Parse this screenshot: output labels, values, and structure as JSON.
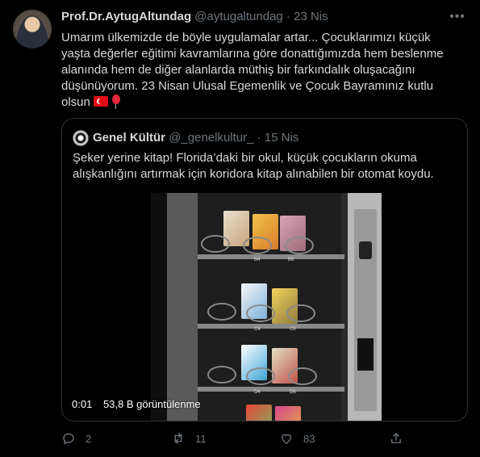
{
  "tweet": {
    "author_name": "Prof.Dr.AytugAltundag",
    "handle": "@aytugaltundag",
    "separator": "·",
    "date": "23 Nis",
    "more_label": "•••",
    "text": "Umarım ülkemizde de böyle uygulamalar artar... Çocuklarımızı küçük yaşta değerler eğitimi kavramlarına göre donattığımızda hem beslenme alanında hem de diğer alanlarda müthiş bir farkındalık oluşacağını düşünüyorum. 23 Nisan Ulusal Egemenlik ve Çocuk Bayramınız kutlu olsun",
    "emoji": [
      "turkish-flag-emoji",
      "balloon-emoji"
    ]
  },
  "quoted": {
    "author_name": "Genel Kültür",
    "handle": "@_genelkultur_",
    "separator": "·",
    "date": "15 Nis",
    "text": "Şeker yerine kitap!  Florida’daki bir okul, küçük çocukların okuma alışkanlığını artırmak için koridora kitap alınabilen bir otomat koydu.",
    "video": {
      "time": "0:01",
      "views": "53,8 B görüntülenme",
      "slot_labels": [
        "B4",
        "B6",
        "C4",
        "C6",
        "D4",
        "D6"
      ]
    }
  },
  "actions": {
    "reply": {
      "icon": "reply-icon",
      "count": "2"
    },
    "retweet": {
      "icon": "retweet-icon",
      "count": "11"
    },
    "like": {
      "icon": "heart-icon",
      "count": "83"
    },
    "share": {
      "icon": "share-icon"
    }
  },
  "colors": {
    "background": "#000000",
    "text": "#d9d9d9",
    "muted": "#6e767d",
    "border": "#2f3336"
  }
}
